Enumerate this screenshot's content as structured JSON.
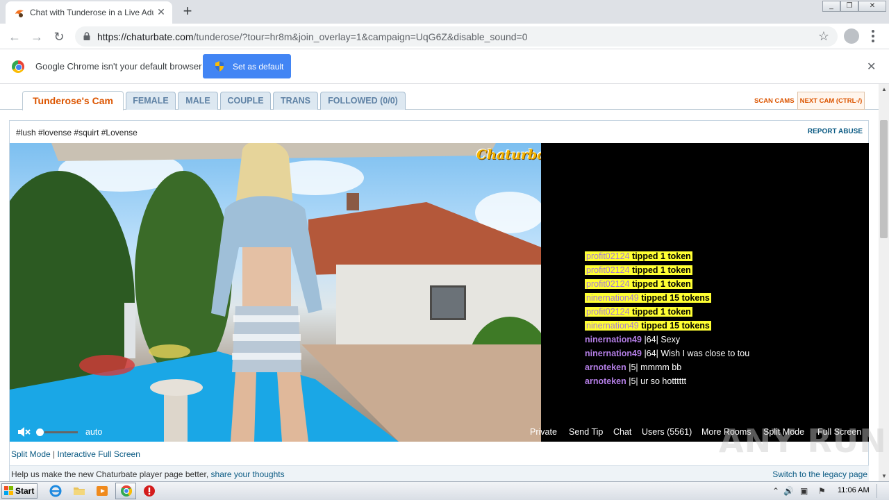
{
  "browser": {
    "tab_title": "Chat with Tunderose in a Live Adult",
    "url_host": "https://chaturbate.com",
    "url_path": "/tunderose/?tour=hr8m&join_overlay=1&campaign=UqG6Z&disable_sound=0"
  },
  "infobar": {
    "message": "Google Chrome isn't your default browser",
    "button_label": "Set as default"
  },
  "room_tabs": [
    {
      "label": "Tunderose's Cam",
      "active": true
    },
    {
      "label": "FEMALE"
    },
    {
      "label": "MALE"
    },
    {
      "label": "COUPLE"
    },
    {
      "label": "TRANS"
    },
    {
      "label": "FOLLOWED (0/0)"
    }
  ],
  "scan_cams": "SCAN CAMS",
  "next_cam": "NEXT CAM (CTRL-/)",
  "room_subject": "#lush #lovense #squirt #Lovense",
  "report_abuse": "REPORT ABUSE",
  "player_logo": "Chaturbate",
  "chat_overlay": [
    {
      "kind": "tip",
      "user": "profit02124",
      "text": "tipped 1 token"
    },
    {
      "kind": "tip",
      "user": "profit02124",
      "text": "tipped 1 token"
    },
    {
      "kind": "tip",
      "user": "profit02124",
      "text": "tipped 1 token"
    },
    {
      "kind": "tip",
      "user": "ninernation49",
      "text": "tipped 15 tokens"
    },
    {
      "kind": "tip",
      "user": "profit02124",
      "text": "tipped 1 token"
    },
    {
      "kind": "tip",
      "user": "ninernation49",
      "text": "tipped 15 tokens"
    },
    {
      "kind": "msg",
      "user": "ninernation49",
      "text": "|64| Sexy"
    },
    {
      "kind": "msg",
      "user": "ninernation49",
      "text": "|64| Wish I was close to tou"
    },
    {
      "kind": "msg",
      "user": "arnoteken",
      "text": "|5| mmmm bb"
    },
    {
      "kind": "msg",
      "user": "arnoteken",
      "text": "|5| ur so hotttttt"
    }
  ],
  "player_controls": {
    "quality": "auto",
    "private": "Private",
    "send_tip": "Send Tip",
    "chat": "Chat",
    "users": "Users (5561)",
    "more_rooms": "More Rooms",
    "split_mode": "Split Mode",
    "full_screen": "Full Screen"
  },
  "below_player": {
    "split_mode": "Split Mode",
    "separator": "|",
    "interactive_full_screen": "Interactive Full Screen"
  },
  "feedback": {
    "text": "Help us make the new Chaturbate player page better,",
    "link": "share your thoughts",
    "legacy": "Switch to the legacy page"
  },
  "watermark": "ANY RUN",
  "taskbar": {
    "start": "Start",
    "clock": "11:06 AM"
  },
  "colors": {
    "accent_orange": "#dc5500",
    "link_blue": "#0a5a83",
    "tip_yellow": "#ffff33",
    "username_purple": "#b47ee6",
    "chrome_blue": "#4285f4"
  }
}
